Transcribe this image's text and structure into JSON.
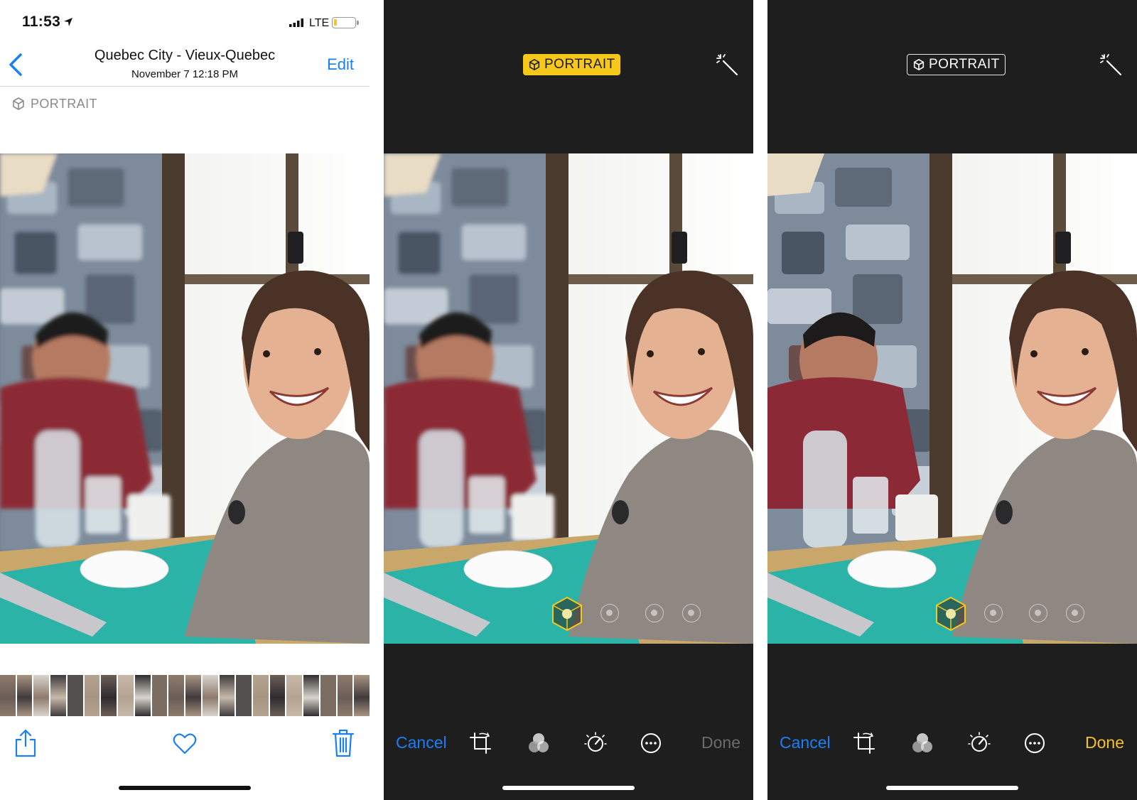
{
  "viewer": {
    "status": {
      "time": "11:53",
      "carrier": "LTE"
    },
    "nav": {
      "title": "Quebec City - Vieux-Quebec",
      "subtitle": "November 7  12:18 PM",
      "edit_label": "Edit"
    },
    "portrait_label": "PORTRAIT",
    "filmstrip_count": 22
  },
  "edit_before": {
    "portrait_badge": "PORTRAIT",
    "portrait_active": true,
    "cancel_label": "Cancel",
    "done_label": "Done",
    "done_enabled": false
  },
  "edit_after": {
    "portrait_badge": "PORTRAIT",
    "portrait_active": false,
    "cancel_label": "Cancel",
    "done_label": "Done",
    "done_enabled": true
  },
  "icons": [
    "location-arrow-icon",
    "signal-bars-icon",
    "battery-icon",
    "back-chevron-icon",
    "portrait-cube-icon",
    "share-icon",
    "heart-icon",
    "trash-icon",
    "magic-wand-icon",
    "portrait-lighting-cube-icon",
    "crop-rotate-icon",
    "filters-icon",
    "adjust-dial-icon",
    "more-icon"
  ],
  "colors": {
    "accent_blue": "#1a7ff5",
    "portrait_yellow": "#f7c81c",
    "done_active": "#f4c129",
    "done_disabled": "#6b6b6b",
    "dark_bg": "#1e1e1e"
  }
}
